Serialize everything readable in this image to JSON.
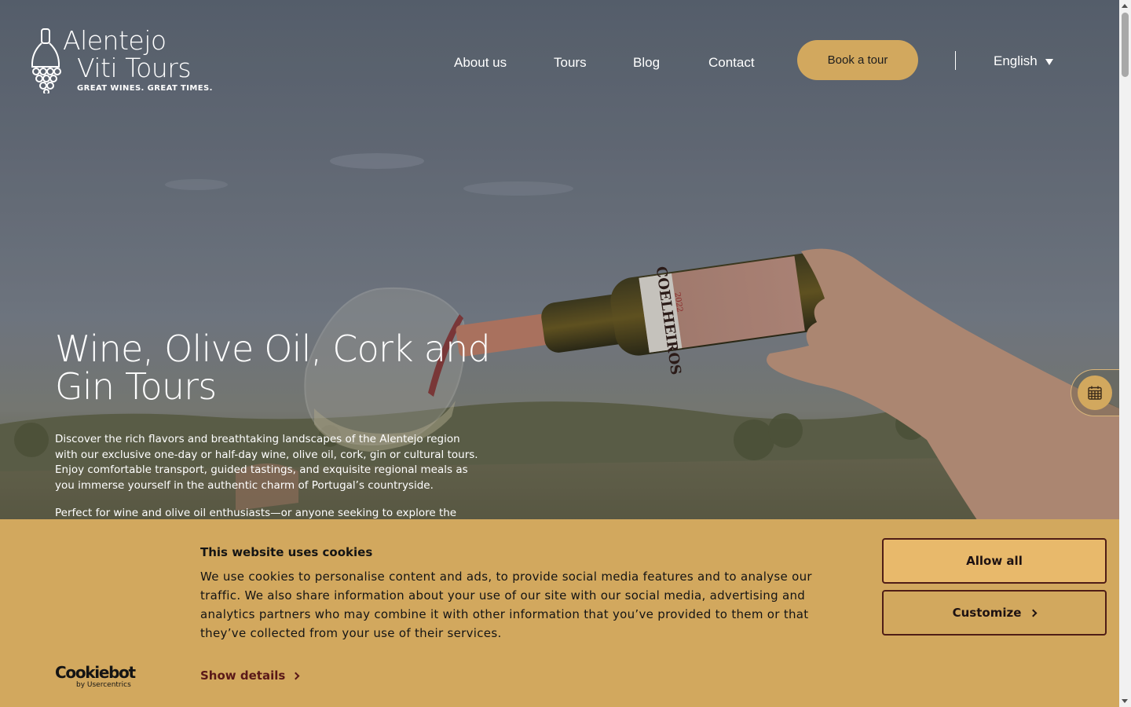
{
  "brand": {
    "line1": "Alentejo",
    "line2": "Viti Tours",
    "tagline": "GREAT WINES. GREAT TIMES."
  },
  "nav": {
    "items": [
      {
        "label": "About us"
      },
      {
        "label": "Tours"
      },
      {
        "label": "Blog"
      },
      {
        "label": "Contact"
      }
    ],
    "book_label": "Book a tour",
    "language": "English"
  },
  "hero": {
    "title": "Wine, Olive Oil, Cork and Gin Tours",
    "paragraph1": "Discover the rich flavors and breathtaking landscapes of the Alentejo region with our exclusive one-day or half-day wine, olive oil, cork, gin or cultural tours. Enjoy comfortable transport, guided tastings, and exquisite regional meals as you immerse yourself in the authentic charm of Portugal’s countryside.",
    "paragraph2": "Perfect for wine and olive oil enthusiasts—or anyone seeking to explore the",
    "bottle_label": "COELHEIROS",
    "bottle_year": "2022"
  },
  "cookie_banner": {
    "title": "This website uses cookies",
    "text": "We use cookies to personalise content and ads, to provide social media features and to analyse our traffic. We also share information about your use of our site with our social media, advertising and analytics partners who may combine it with other information that you’ve provided to them or that they’ve collected from your use of their services.",
    "show_details": "Show details",
    "allow_all": "Allow all",
    "customize": "Customize",
    "provider": "Cookiebot",
    "provider_sub": "by Usercentrics"
  },
  "colors": {
    "accent": "#d2a85e",
    "button_border": "#4f1d16",
    "link": "#5a1818"
  },
  "icons": [
    "grape-bottle-logo-icon",
    "chevron-down-icon",
    "calendar-icon",
    "chevron-right-icon"
  ]
}
